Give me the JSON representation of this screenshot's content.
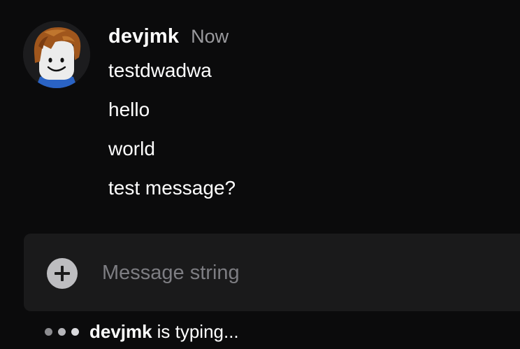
{
  "message_group": {
    "username": "devjmk",
    "timestamp": "Now",
    "avatar_icon": "roblox-avatar-icon",
    "messages": [
      "testdwadwa",
      "hello",
      "world",
      "test message?"
    ]
  },
  "composer": {
    "add_icon": "plus-circle-icon",
    "placeholder": "Message string",
    "value": ""
  },
  "typing_indicator": {
    "user": "devjmk",
    "text": "is typing..."
  },
  "colors": {
    "background": "#0b0b0c",
    "composer_background": "#1a1a1b",
    "timestamp": "#9a9a9e",
    "placeholder": "#7d7d82",
    "text": "#ffffff"
  }
}
